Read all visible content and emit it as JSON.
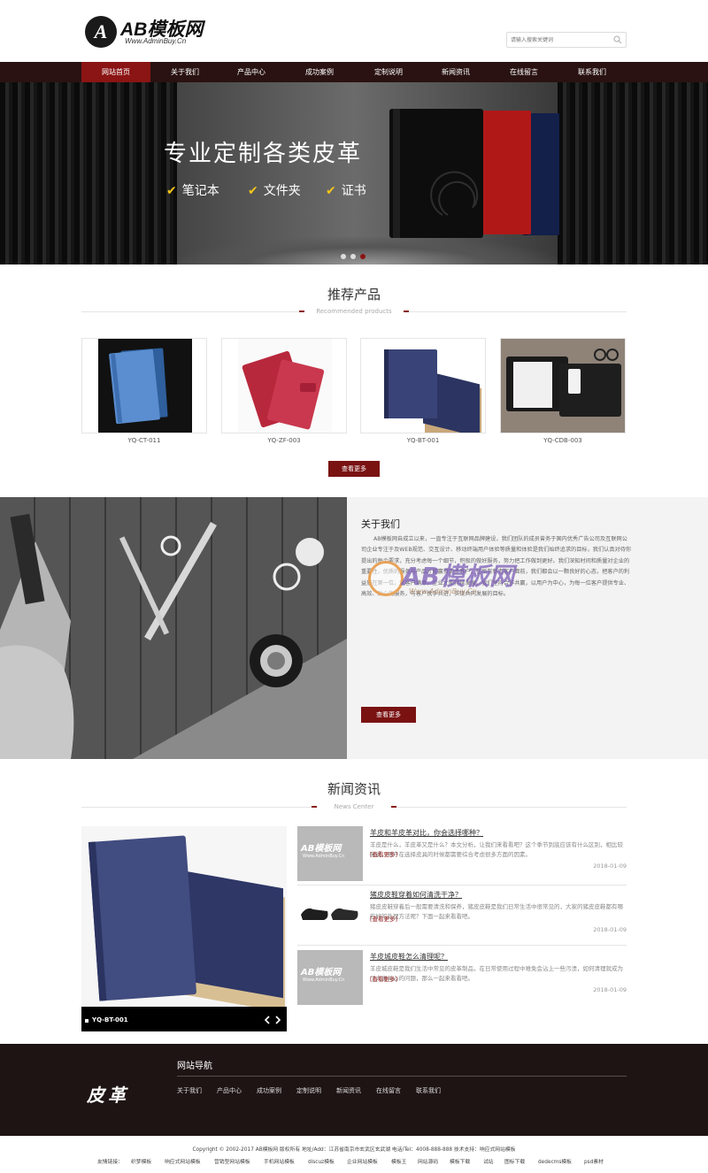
{
  "header": {
    "logo_letter": "A",
    "logo_title": "AB模板网",
    "logo_url": "Www.AdminBuy.Cn",
    "search_placeholder": "请输入搜索关键词"
  },
  "nav": {
    "items": [
      {
        "label": "网站首页",
        "active": true
      },
      {
        "label": "关于我们"
      },
      {
        "label": "产品中心"
      },
      {
        "label": "成功案例"
      },
      {
        "label": "定制说明"
      },
      {
        "label": "新闻资讯"
      },
      {
        "label": "在线留言"
      },
      {
        "label": "联系我们"
      }
    ]
  },
  "banner": {
    "headline": "专业定制各类皮革",
    "features": [
      "笔记本",
      "文件夹",
      "证书"
    ],
    "check_symbol": "✔",
    "slides": 3,
    "active_slide": 3
  },
  "products": {
    "title": "推荐产品",
    "subtitle": "Recommended products",
    "items": [
      {
        "name": "YQ-CT-011"
      },
      {
        "name": "YQ-ZF-003"
      },
      {
        "name": "YQ-BT-001"
      },
      {
        "name": "YQ-CDB-003"
      }
    ],
    "more_label": "查看更多"
  },
  "about": {
    "title": "关于我们",
    "text": "AB模板网自成立以来，一直专注于互联网品牌建设，我们团队的成员曾务于国内优秀广告公司及互联网公司企业专注于及WEB规范、交互设计、移动终端用户体验等质量和体验是我们始终追求的目标，我们认真对待你提出的每个要求，充分考虑每一个细节，积极的做好服务，努力把工作做到更好。我们深知时间和质量对企业的重要性，优质的服务与产品才能赢得更多客户。在所有新老客户面前，我们都会以一颗良好的心态，把客户的利益放在第一位，让客户满意，企业才能持续发展。我们坚持合作共赢，以用户为中心，为每一位客户提供专业、高效、贴心的服务，与客户携手共进，实现共同发展的目标。",
    "watermark": "AB模板网",
    "watermark_url": "Www.AdminBuy.Cn",
    "more_label": "查看更多"
  },
  "news": {
    "title": "新闻资讯",
    "subtitle": "News Center",
    "featured_caption": "YQ-BT-001",
    "items": [
      {
        "title": "羊皮和羊皮革对比，你会选择哪种？",
        "summary": "羊皮是什么，羊皮革又是什么？本文分析，让我们来看看吧？这个季节到底应该有什么区别，相比较来说，用户在选择皮具的时候都需要综合考虑很多方面的因素。",
        "link": "[查看更多]",
        "date": "2018-01-09",
        "thumb_text": "AB模板网",
        "thumb_sub": "Www.AdminBuy.Cn"
      },
      {
        "title": "猪皮皮鞋穿着如何清洗干净？",
        "summary": "猪皮皮鞋穿着后一般需要清洗和保养，猪皮皮鞋是我们日常生活中很常见的，大家的猪皮皮鞋都有哪些好的处理方法呢？下面一起来看看吧。",
        "link": "[查看更多]",
        "date": "2018-01-09"
      },
      {
        "title": "羊皮城皮鞋怎么清理呢？",
        "summary": "羊皮城皮鞋是我们生活中常见的皮革制品，在日常使用过程中难免会沾上一些污渍，如何清理就成为了大家关心的问题，那么一起来看看吧。",
        "link": "[查看更多]",
        "date": "2018-01-09",
        "thumb_text": "AB模板网",
        "thumb_sub": "Www.AdminBuy.Cn"
      }
    ]
  },
  "footer": {
    "brand": "皮革",
    "nav_title": "网站导航",
    "links": [
      "关于我们",
      "产品中心",
      "成功案例",
      "定制说明",
      "新闻资讯",
      "在线留言",
      "联系我们"
    ],
    "copyright": "Copyright © 2002-2017 AB模板网 版权所有 地址/Add：江苏省南京市玄武区玄武湖 电话/Tel：4008-888-888 技术支持：响应式网站模板",
    "friend_label": "友情链接：",
    "friend_links": [
      "织梦模板",
      "响应式网站模板",
      "营销型网站模板",
      "手机网站模板",
      "discuz模板",
      "企业网站模板",
      "模板王",
      "网站源码",
      "模板下载",
      "试站",
      "图标下载",
      "dedecms模板",
      "psd素材"
    ]
  },
  "colors": {
    "accent": "#8b1414",
    "nav_bg": "#2a1212",
    "footer_bg": "#1e1414",
    "check": "#f5c518"
  }
}
